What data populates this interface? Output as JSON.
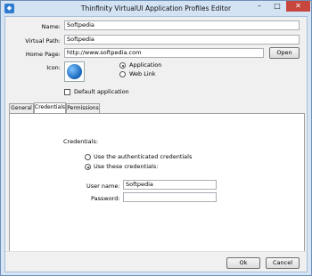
{
  "window": {
    "title": "Thinfinity VirtualUI Application Profiles Editor",
    "minimize_glyph": "–",
    "maximize_glyph": "□",
    "close_glyph": "✕"
  },
  "profile": {
    "name_label": "Name:",
    "name_value": "Softpedia",
    "virtual_path_label": "Virtual Path:",
    "virtual_path_value": "Softpedia",
    "home_page_label": "Home Page:",
    "home_page_value": "http://www.softpedia.com",
    "open_button": "Open",
    "icon_label": "Icon:",
    "type_options": [
      {
        "label": "Application",
        "selected": true
      },
      {
        "label": "Web Link",
        "selected": false
      }
    ],
    "default_app_label": "Default application",
    "default_app_checked": false
  },
  "tabs": [
    {
      "label": "General",
      "active": false
    },
    {
      "label": "Credentials",
      "active": true
    },
    {
      "label": "Permissions",
      "active": false
    }
  ],
  "credentials": {
    "heading": "Credentials:",
    "options": [
      {
        "label": "Use the authenticated credentials",
        "selected": false
      },
      {
        "label": "Use these credentials:",
        "selected": true
      }
    ],
    "username_label": "User name:",
    "username_value": "Softpedia",
    "password_label": "Password:",
    "password_value": ""
  },
  "footer": {
    "ok_button": "Ok",
    "cancel_button": "Cancel"
  }
}
